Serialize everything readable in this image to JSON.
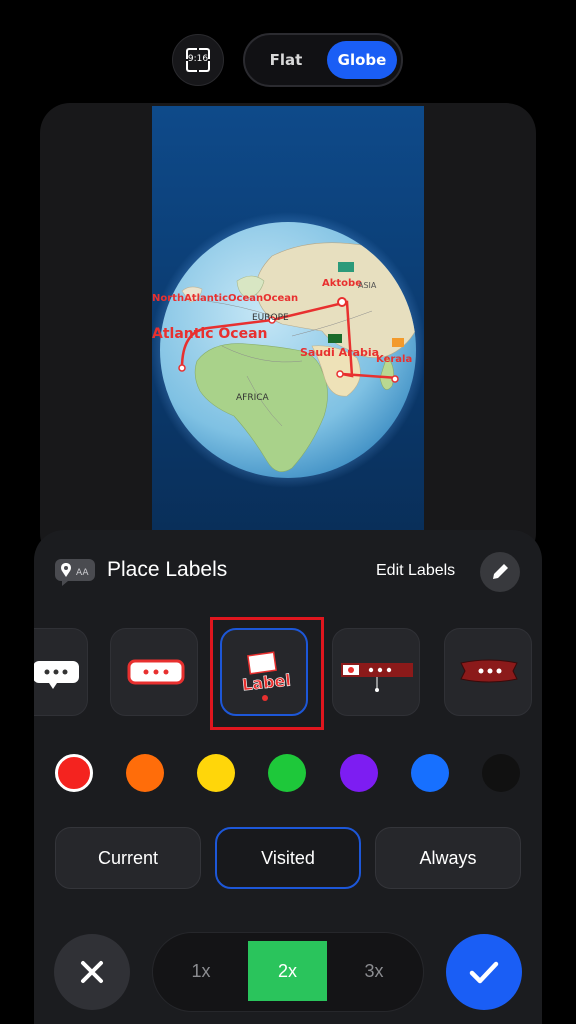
{
  "top_bar": {
    "aspect_ratio": "9:16",
    "view_toggle": {
      "options": [
        "Flat",
        "Globe"
      ],
      "selected": "Globe"
    }
  },
  "map_preview": {
    "place_labels": [
      "NorthAtlanticOceanOcean",
      "Atlantic Ocean",
      "Aktobe",
      "Saudi Arabia",
      "Kerala"
    ],
    "region_labels": [
      "EUROPE",
      "AFRICA",
      "ASIA"
    ]
  },
  "sheet": {
    "title": "Place Labels",
    "edit_labels": "Edit Labels",
    "selected_style_text": "Label",
    "styles": [
      "speech-bubble",
      "red-pill",
      "label-stamp",
      "flag-banner",
      "red-ribbon"
    ],
    "selected_style_index": 2,
    "colors": [
      "#f4231f",
      "#ff6d0a",
      "#ffd60a",
      "#1ec83a",
      "#7d1df2",
      "#1770ff",
      "#111111"
    ],
    "selected_color_index": 0,
    "visibility_options": [
      "Current",
      "Visited",
      "Always"
    ],
    "selected_visibility": "Visited",
    "speed_options": [
      "1x",
      "2x",
      "3x"
    ],
    "selected_speed": "2x"
  },
  "theme": {
    "accent": "#1a5ef5",
    "active_speed": "#2ac45c",
    "highlight_box": "#e0161e",
    "label_red": "#e8302f"
  }
}
